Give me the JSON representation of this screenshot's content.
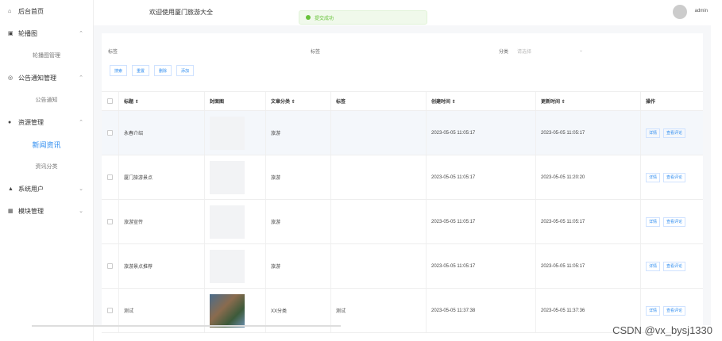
{
  "sidebar": {
    "home": "后台首页",
    "carousel": "轮播图",
    "carousel_mgmt": "轮播图管理",
    "notice": "公告通知管理",
    "notice_sub": "公告通知",
    "resource": "资源管理",
    "news": "新闻资讯",
    "news_category": "资讯分类",
    "users": "系统用户",
    "modules": "模块管理"
  },
  "topbar": {
    "welcome": "欢迎使用厦门旅游大全",
    "toast": "提交成功",
    "user": "admin"
  },
  "search": {
    "label1": "标签",
    "label2": "标签",
    "category_label": "分类",
    "category_placeholder": "请选择"
  },
  "buttons": {
    "search": "搜索",
    "reset": "重置",
    "delete": "删除",
    "add": "添加"
  },
  "table": {
    "headers": [
      "",
      "标题 ⇕",
      "封面图",
      "文章分类 ⇕",
      "标签",
      "创建时间 ⇕",
      "更新时间 ⇕",
      "操作"
    ],
    "rows": [
      {
        "title": "永春介绍",
        "category": "旅游",
        "tag": "",
        "created": "2023-05-05 11:05:17",
        "updated": "2023-05-05 11:05:17",
        "op1": "详情",
        "op2": "查看评论",
        "hasImg": false
      },
      {
        "title": "厦门旅游景点",
        "category": "旅游",
        "tag": "",
        "created": "2023-05-05 11:05:17",
        "updated": "2023-05-05 11:20:20",
        "op1": "详情",
        "op2": "查看评论",
        "hasImg": false
      },
      {
        "title": "旅游宣传",
        "category": "旅游",
        "tag": "",
        "created": "2023-05-05 11:05:17",
        "updated": "2023-05-05 11:05:17",
        "op1": "详情",
        "op2": "查看评论",
        "hasImg": false
      },
      {
        "title": "旅游景点推荐",
        "category": "旅游",
        "tag": "",
        "created": "2023-05-05 11:05:17",
        "updated": "2023-05-05 11:05:17",
        "op1": "详情",
        "op2": "查看评论",
        "hasImg": false
      },
      {
        "title": "测试",
        "category": "XX分类",
        "tag": "测试",
        "created": "2023-05-05 11:37:38",
        "updated": "2023-05-05 11:37:36",
        "op1": "详情",
        "op2": "查看评论",
        "hasImg": true
      }
    ]
  },
  "watermark": "CSDN @vx_bysj1330"
}
